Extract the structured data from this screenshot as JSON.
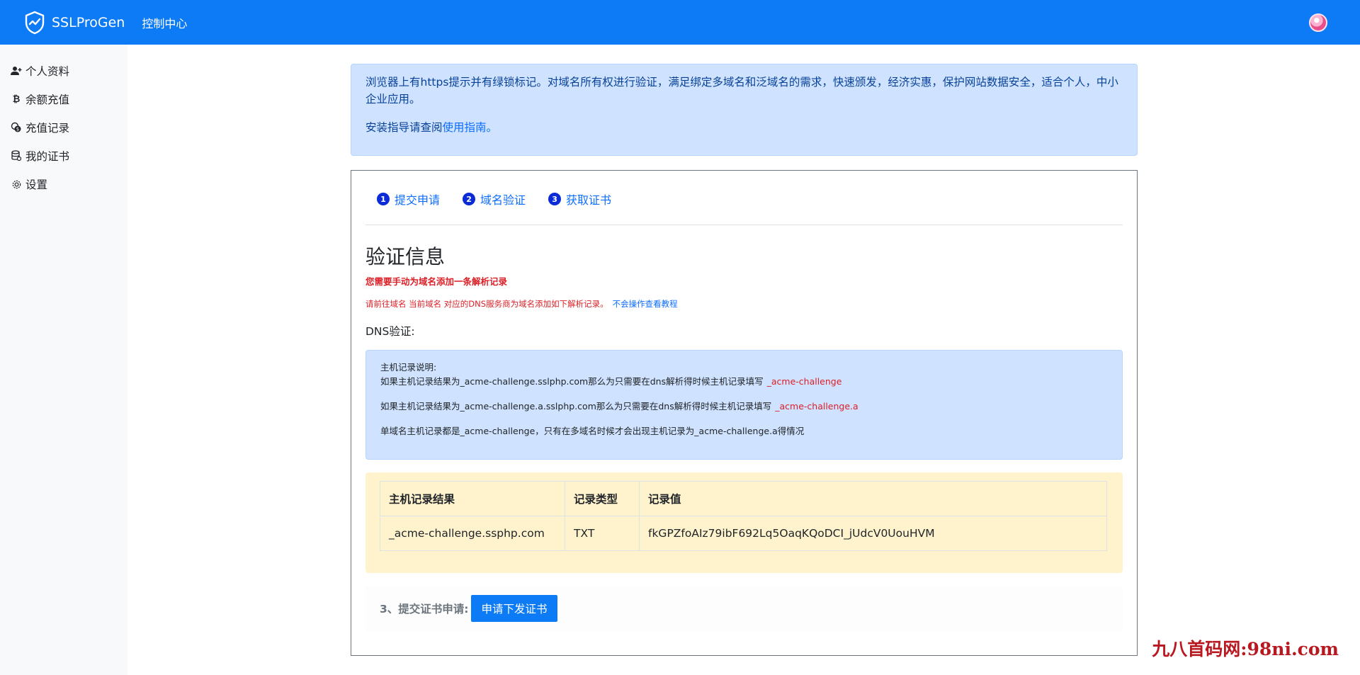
{
  "header": {
    "brand": "SSLProGen",
    "nav_label": "控制中心"
  },
  "sidebar": {
    "items": [
      {
        "icon": "user-plus-icon",
        "label": "个人资料"
      },
      {
        "icon": "bitcoin-icon",
        "label": "余额充值"
      },
      {
        "icon": "coins-icon",
        "label": "充值记录"
      },
      {
        "icon": "database-icon",
        "label": "我的证书"
      },
      {
        "icon": "gear-icon",
        "label": "设置"
      }
    ]
  },
  "intro": {
    "line1": "浏览器上有https提示并有绿锁标记。对域名所有权进行验证，满足绑定多域名和泛域名的需求，快速颁发，经济实惠，保护网站数据安全，适合个人，中小企业应用。",
    "guide_prefix": "安装指导请查阅",
    "guide_link": "使用指南。"
  },
  "steps": [
    {
      "num": "1",
      "label": "提交申请"
    },
    {
      "num": "2",
      "label": "域名验证"
    },
    {
      "num": "3",
      "label": "获取证书"
    }
  ],
  "verify": {
    "title": "验证信息",
    "warning_bold": "您需要手动为域名添加一条解析记录",
    "warning_line": "请前往域名 当前域名 对应的DNS服务商为域名添加如下解析记录。",
    "tutorial_link": "不会操作查看教程",
    "dns_label": "DNS验证:"
  },
  "host_note": {
    "title": "主机记录说明:",
    "line1": "如果主机记录结果为_acme-challenge.sslphp.com那么为只需要在dns解析得时候主机记录填写",
    "line1_value": "_acme-challenge",
    "line2": "如果主机记录结果为_acme-challenge.a.sslphp.com那么为只需要在dns解析得时候主机记录填写",
    "line2_value": "_acme-challenge.a",
    "line3": "单域名主机记录都是_acme-challenge，只有在多域名时候才会出现主机记录为_acme-challenge.a得情况"
  },
  "record_table": {
    "headers": [
      "主机记录结果",
      "记录类型",
      "记录值"
    ],
    "rows": [
      [
        "_acme-challenge.ssphp.com",
        "TXT",
        "fkGPZfoAIz79ibF692Lq5OaqKQoDCI_jUdcV0UouHVM"
      ]
    ]
  },
  "submit": {
    "label": "3、提交证书申请:",
    "button": "申请下发证书"
  },
  "watermark": "九八首码网:98ni.com",
  "colors": {
    "primary": "#0d7bf5",
    "info_bg": "#cfe2ff",
    "warning_bg": "#fff3cd",
    "danger": "#dc1f26"
  }
}
